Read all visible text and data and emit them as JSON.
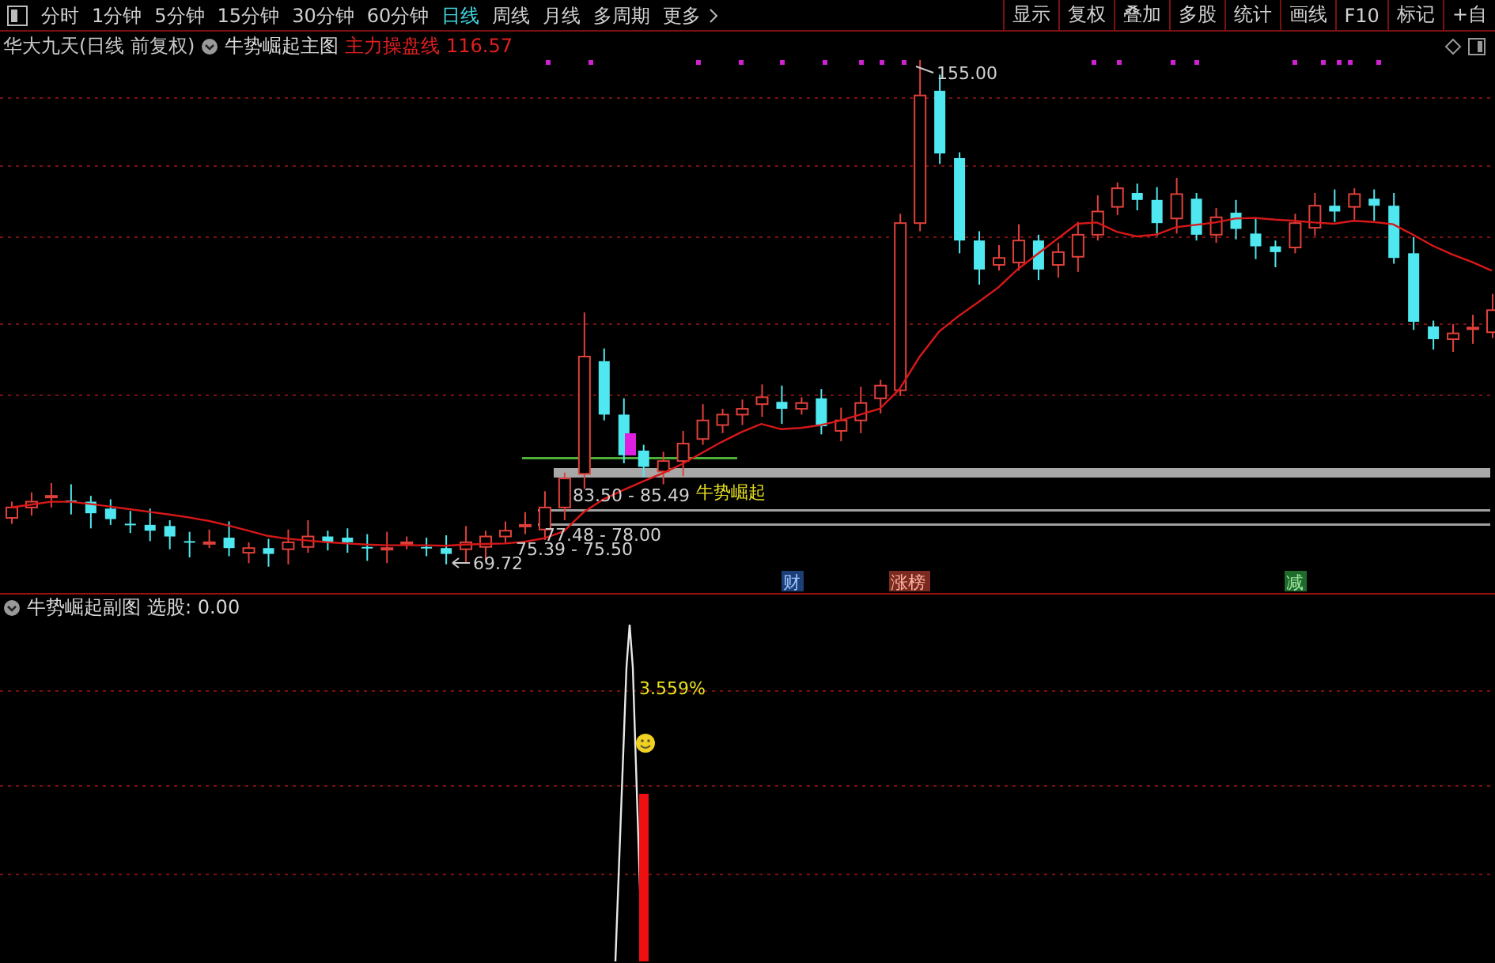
{
  "toolbar": {
    "periods": [
      {
        "label": "分时",
        "selected": false
      },
      {
        "label": "1分钟",
        "selected": false
      },
      {
        "label": "5分钟",
        "selected": false
      },
      {
        "label": "15分钟",
        "selected": false
      },
      {
        "label": "30分钟",
        "selected": false
      },
      {
        "label": "60分钟",
        "selected": false
      },
      {
        "label": "日线",
        "selected": true
      },
      {
        "label": "周线",
        "selected": false
      },
      {
        "label": "月线",
        "selected": false
      },
      {
        "label": "多周期",
        "selected": false
      },
      {
        "label": "更多",
        "selected": false
      }
    ],
    "buttons": [
      "显示",
      "复权",
      "叠加",
      "多股",
      "统计",
      "画线",
      "F10",
      "标记",
      "+自"
    ]
  },
  "main_chart": {
    "stock": "华大九天(日线 前复权)",
    "indicator": "牛势崛起主图",
    "line_label": "主力操盘线 116.57",
    "high_label": "155.00",
    "low_label": "69.72",
    "signal_label": "牛势崛起",
    "ranges": [
      "83.50 - 85.49",
      "77.48 - 78.00",
      "75.39 - 75.50"
    ],
    "events": [
      {
        "label": "财",
        "color": "#1d3f78"
      },
      {
        "label": "涨榜",
        "color": "#7a2a1e"
      },
      {
        "label": "减",
        "color": "#1d6a2a"
      }
    ]
  },
  "sub_chart": {
    "indicator": "牛势崛起副图",
    "reading": "选股: 0.00",
    "value_label": "3.559%"
  }
}
